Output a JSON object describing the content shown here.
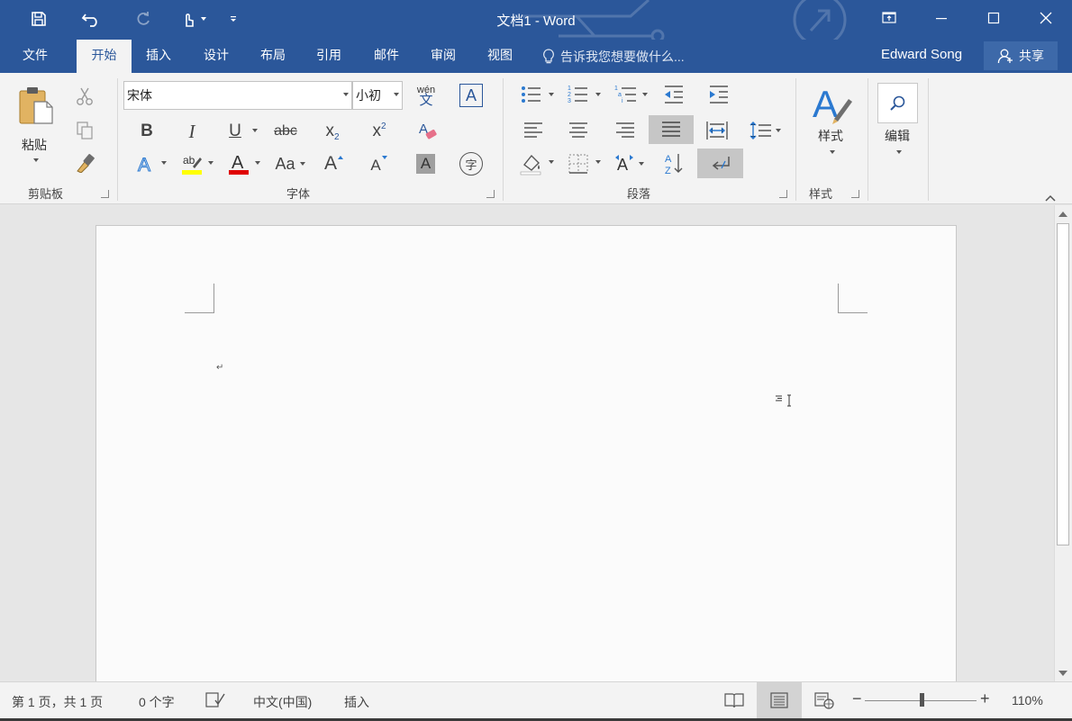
{
  "window": {
    "title": "文档1 - Word",
    "accent": "#2b579a"
  },
  "quick_access": {
    "icons": [
      "save-icon",
      "undo-icon",
      "redo-icon",
      "touch-mode-icon",
      "customize-icon"
    ]
  },
  "tabs": [
    {
      "label": "文件"
    },
    {
      "label": "开始"
    },
    {
      "label": "插入"
    },
    {
      "label": "设计"
    },
    {
      "label": "布局"
    },
    {
      "label": "引用"
    },
    {
      "label": "邮件"
    },
    {
      "label": "审阅"
    },
    {
      "label": "视图"
    }
  ],
  "active_tab": "开始",
  "tell_me": "告诉我您想要做什么...",
  "user_name": "Edward Song",
  "share_label": "共享",
  "ribbon": {
    "clipboard": {
      "paste_label": "粘贴",
      "group_label": "剪贴板"
    },
    "font": {
      "font_name": "宋体",
      "font_size": "小初",
      "phonetic_top": "wén",
      "phonetic_bottom": "文",
      "bold": "B",
      "italic": "I",
      "underline": "U",
      "strike": "abc",
      "subscript": "x",
      "subscript_mark": "2",
      "superscript": "x",
      "superscript_mark": "2",
      "change_case": "Aa",
      "grow": "A",
      "shrink": "A",
      "shading": "A",
      "enclose": "字",
      "border_char": "A",
      "group_label": "字体"
    },
    "paragraph": {
      "group_label": "段落"
    },
    "styles": {
      "label": "样式",
      "group_label": "样式"
    },
    "editing": {
      "label": "编辑"
    }
  },
  "status": {
    "page": "第 1 页，共 1 页",
    "words": "0 个字",
    "language": "中文(中国)",
    "mode": "插入",
    "zoom": "110%"
  }
}
